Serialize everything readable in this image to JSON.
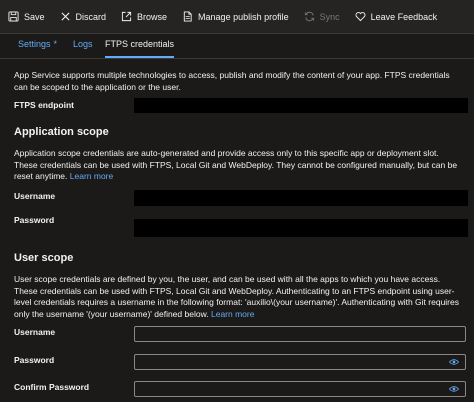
{
  "toolbar": {
    "save": "Save",
    "discard": "Discard",
    "browse": "Browse",
    "manage_publish_profile": "Manage publish profile",
    "sync": "Sync",
    "leave_feedback": "Leave Feedback"
  },
  "tabs": {
    "settings": "Settings",
    "settings_marker": "*",
    "logs": "Logs",
    "ftps_credentials": "FTPS credentials"
  },
  "intro": "App Service supports multiple technologies to access, publish and modify the content of your app. FTPS credentials can be scoped to the application or the user.",
  "ftps_endpoint_label": "FTPS endpoint",
  "application_scope": {
    "heading": "Application scope",
    "description": "Application scope credentials are auto-generated and provide access only to this specific app or deployment slot. These credentials can be used with FTPS, Local Git and WebDeploy. They cannot be configured manually, but can be reset anytime.",
    "learn_more": "Learn more",
    "username_label": "Username",
    "password_label": "Password"
  },
  "user_scope": {
    "heading": "User scope",
    "description": "User scope credentials are defined by you, the user, and can be used with all the apps to which you have access. These credentials can be used with FTPS, Local Git and WebDeploy. Authenticating to an FTPS endpoint using user-level credentials requires a username in the following format: 'auxilio\\(your username)'. Authenticating with Git requires only the username '(your username)' defined below.",
    "learn_more": "Learn more",
    "username_label": "Username",
    "password_label": "Password",
    "confirm_password_label": "Confirm Password"
  },
  "icons": {
    "save": "save-icon",
    "discard": "close-icon",
    "browse": "external-link-icon",
    "manage_publish_profile": "document-icon",
    "sync": "sync-icon",
    "leave_feedback": "heart-icon",
    "reveal_password": "eye-icon"
  },
  "colors": {
    "background": "#1b1a19",
    "toolbar": "#252423",
    "link": "#62abf5",
    "text": "#f3f2f1",
    "disabled": "#797775",
    "redaction": "#000000"
  }
}
